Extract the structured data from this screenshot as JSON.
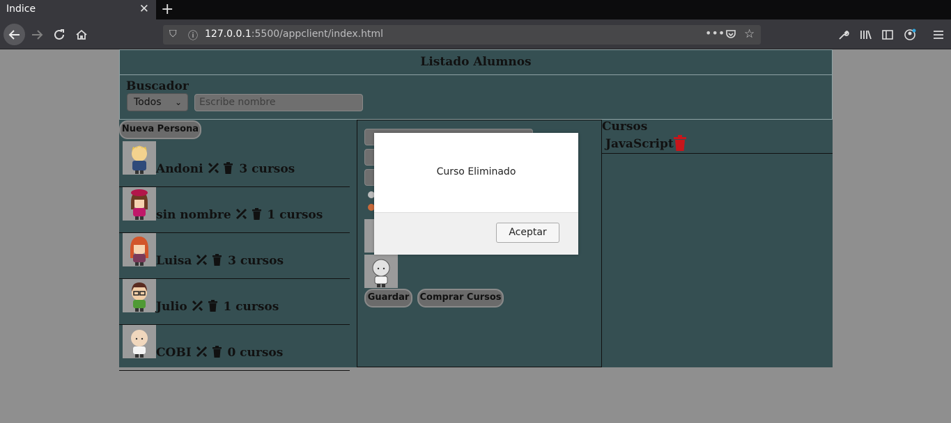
{
  "browser": {
    "tab_title": "Indice",
    "url_host": "127.0.0.1",
    "url_rest": ":5500/appclient/index.html"
  },
  "app": {
    "title": "Listado Alumnos",
    "search": {
      "label": "Buscador",
      "filter_selected": "Todos",
      "placeholder": "Escribe nombre"
    },
    "new_person_label": "Nueva Persona",
    "people": [
      {
        "name": "Andoni",
        "courses": "3 cursos",
        "avatar": "blond-boy-avatar"
      },
      {
        "name": "sin nombre",
        "courses": "1 cursos",
        "avatar": "girl-beret-avatar"
      },
      {
        "name": "Luisa",
        "courses": "3 cursos",
        "avatar": "redhead-girl-avatar"
      },
      {
        "name": "Julio",
        "courses": "1 cursos",
        "avatar": "boy-glasses-avatar"
      },
      {
        "name": "COBI",
        "courses": "0 cursos",
        "avatar": "bald-avatar"
      }
    ],
    "form": {
      "save_label": "Guardar",
      "buy_label": "Comprar Cursos"
    },
    "courses_panel": {
      "title": "Cursos",
      "items": [
        "JavaScript"
      ]
    }
  },
  "modal": {
    "message": "Curso Eliminado",
    "accept_label": "Aceptar"
  },
  "colors": {
    "app_bg": "#354f52",
    "trash_red": "#c8161b"
  }
}
